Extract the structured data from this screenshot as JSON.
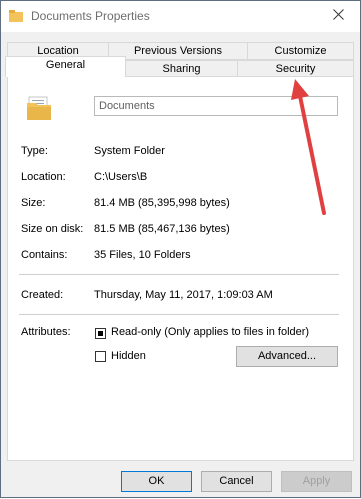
{
  "window": {
    "title": "Documents Properties"
  },
  "tabs": {
    "top_row": [
      "Location",
      "Previous Versions",
      "Customize"
    ],
    "bottom_row": [
      "General",
      "Sharing",
      "Security"
    ],
    "active": "General"
  },
  "general": {
    "folder_name": "Documents",
    "fields": [
      {
        "label": "Type:",
        "value": "System Folder"
      },
      {
        "label": "Location:",
        "value": "C:\\Users\\B"
      },
      {
        "label": "Size:",
        "value": "81.4 MB (85,395,998 bytes)"
      },
      {
        "label": "Size on disk:",
        "value": "81.5 MB (85,467,136 bytes)"
      },
      {
        "label": "Contains:",
        "value": "35 Files, 10 Folders"
      }
    ],
    "created_label": "Created:",
    "created_value": "Thursday, May 11, 2017, 1:09:03 AM",
    "attributes_label": "Attributes:",
    "readonly_label": "Read-only (Only applies to files in folder)",
    "readonly_state": "indeterminate",
    "hidden_label": "Hidden",
    "hidden_checked": false,
    "advanced_label": "Advanced..."
  },
  "footer": {
    "ok_label": "OK",
    "cancel_label": "Cancel",
    "apply_label": "Apply"
  },
  "colors": {
    "annotation_arrow": "#e04040",
    "folder": "#f2c35b"
  }
}
